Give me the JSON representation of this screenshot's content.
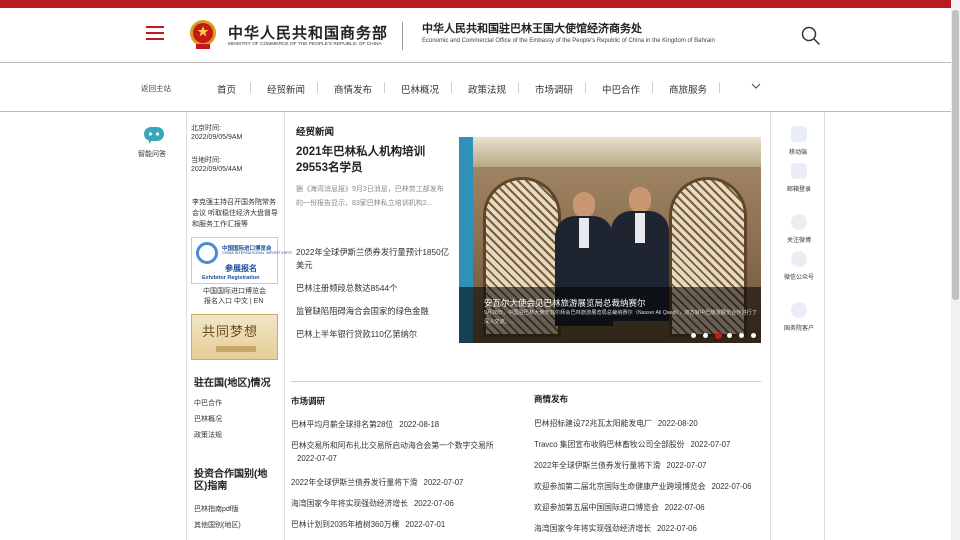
{
  "header": {
    "logo_cn": "中华人民共和国商务部",
    "logo_en": "MINISTRY OF COMMERCE OF THE PEOPLE'S REPUBLIC OF CHINA",
    "office_cn": "中华人民共和国驻巴林王国大使馆经济商务处",
    "office_en": "Economic and Commercial Office of the Embassy of the People's Republic of China in the Kingdom of Bahrain",
    "accent": "#b81c22"
  },
  "nav": {
    "back": "返回主站",
    "items": [
      "首页",
      "经贸新闻",
      "商情发布",
      "巴林概况",
      "政策法规",
      "市场调研",
      "中巴合作",
      "商旅服务"
    ]
  },
  "left": {
    "assistant": "智能问答",
    "beijing_label": "北京时间:",
    "beijing_time": "2022/09/05/9AM",
    "local_label": "当地时间:",
    "local_time": "2022/09/05/4AM",
    "side_news": "李克强主持召开国务院常务会议 听取稳住经济大盘督导和服务工作汇报等",
    "expo_cn": "中国国际进口博览会",
    "expo_en": "CHINA INTERNATIONAL IMPORT EXPO",
    "expo_reg": "参展报名",
    "expo_reg_en": "Exhibitor Registration",
    "expo_caption": "中国国际进口博览会",
    "expo_links": "报名入口 中文 | EN",
    "dream_text": "共同梦想",
    "section1_title": "驻在国(地区)情况",
    "section1_links": [
      "中巴合作",
      "巴林概况",
      "政策法规"
    ],
    "section2_title": "投资合作国别(地区)指南",
    "section2_links": [
      "巴林指南pdf版",
      "其他国别(地区)"
    ]
  },
  "news": {
    "heading": "经贸新闻",
    "headline": "2021年巴林私人机构培训29553名学员",
    "summary": "据《海湾消息报》9月3日消息，巴林劳工部发布的一份报告显示，83家巴林私立培训机构2...",
    "links": [
      "2022年全球伊斯兰债券发行量预计1850亿美元",
      "巴林注册频段总数达8544个",
      "监管缺陷阻碍海合会国家的绿色金融",
      "巴林上半年银行贷款110亿第纳尔"
    ]
  },
  "slider": {
    "caption_title": "安瓦尔大使会见巴林旅游展览局总裁纳赛尔",
    "caption_desc": "9月28日，中国驻巴林大使安瓦尔拜会巴林旅游展览局总裁纳赛尔（Nasser Ali Qaedi），双方就中巴旅游展览合作进行了深入交流。...",
    "dot_count": 6,
    "active_dot": 2
  },
  "right": {
    "items": [
      "移动端",
      "邮箱登录",
      "关注微博",
      "微信公众号",
      "国务院客户"
    ]
  },
  "market": {
    "title": "市场调研",
    "items": [
      {
        "text": "巴林平均月薪全球排名第28位",
        "date": "2022-08-18"
      },
      {
        "text": "巴林交易所和阿布扎比交易所启动海合会第一个数字交易所",
        "date": "2022-07-07"
      },
      {
        "text": "2022年全球伊斯兰债券发行量将下滑",
        "date": "2022-07-07"
      },
      {
        "text": "海湾国家今年将实现强劲经济增长",
        "date": "2022-07-06"
      },
      {
        "text": "巴林计划到2035年植树360万棵",
        "date": "2022-07-01"
      }
    ]
  },
  "business": {
    "title": "商情发布",
    "items": [
      {
        "text": "巴林招标建设72兆瓦太阳能发电厂",
        "date": "2022-08-20"
      },
      {
        "text": "Travco 集团宣布收购巴林畜牧公司全部股份",
        "date": "2022-07-07"
      },
      {
        "text": "2022年全球伊斯兰债券发行量将下滑",
        "date": "2022-07-07"
      },
      {
        "text": "欢迎参加第二届北京国际生命健康产业跨境博览会",
        "date": "2022-07-06"
      },
      {
        "text": "欢迎参加第五届中国国际进口博览会",
        "date": "2022-07-06"
      },
      {
        "text": "海湾国家今年将实现强劲经济增长",
        "date": "2022-07-06"
      }
    ]
  }
}
